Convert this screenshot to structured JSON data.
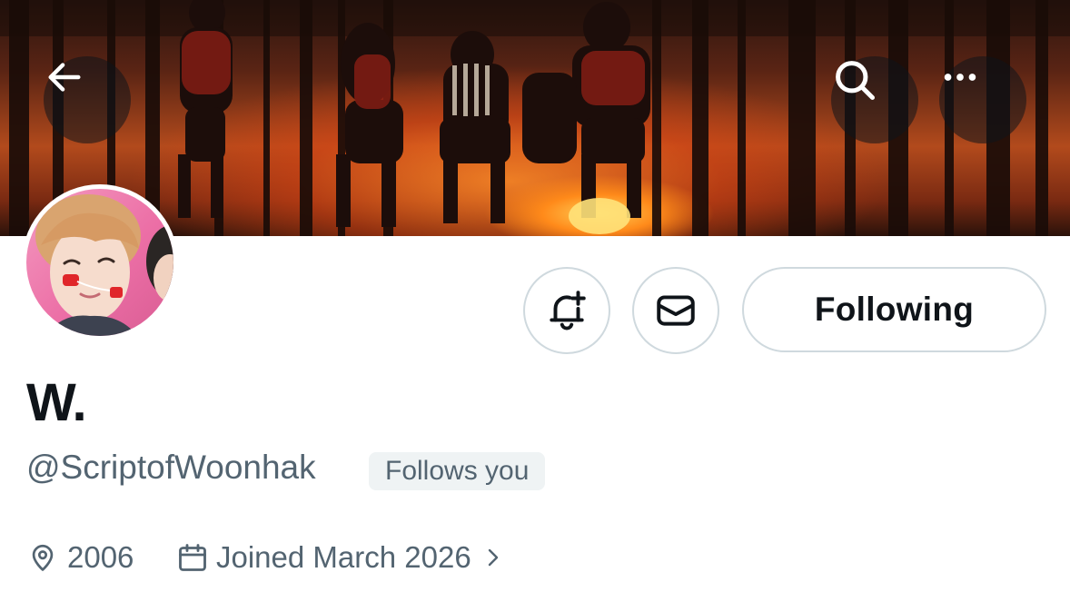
{
  "header": {
    "back_icon": "arrow-left-icon",
    "search_icon": "search-icon",
    "more_icon": "more-horizontal-icon"
  },
  "profile": {
    "display_name": "W.",
    "handle": "@ScriptofWoonhak",
    "follows_you_badge": "Follows you",
    "location": "2006",
    "joined": "Joined March 2026"
  },
  "actions": {
    "notify_icon": "bell-plus-icon",
    "message_icon": "mail-icon",
    "following_label": "Following"
  },
  "colors": {
    "primary_text": "#0f1419",
    "secondary_text": "#536471",
    "border": "#cfd9de",
    "badge_bg": "#eff3f4"
  }
}
